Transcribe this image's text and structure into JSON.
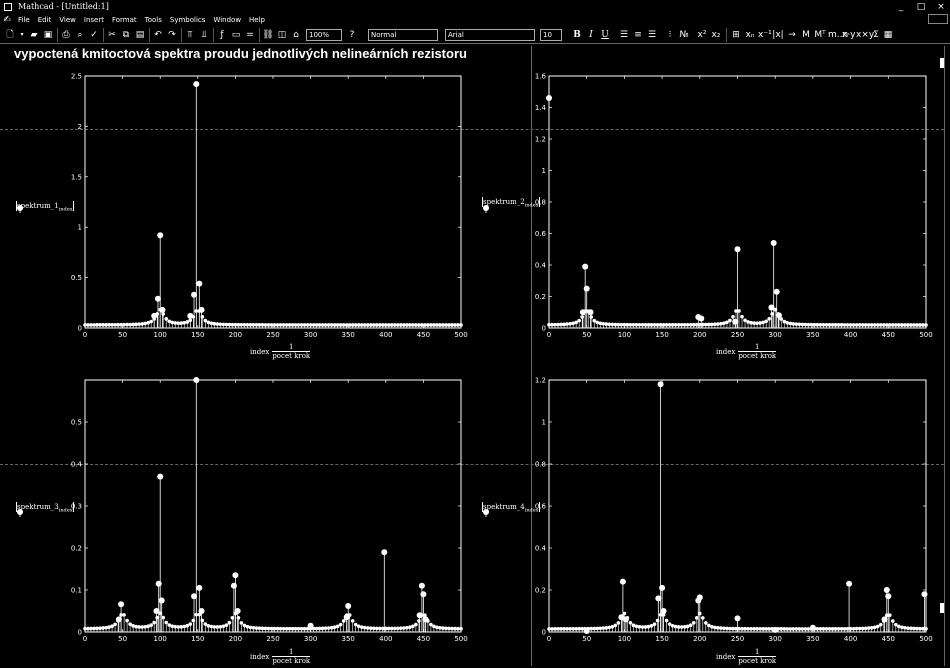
{
  "window": {
    "title": "Mathcad - [Untitled:1]",
    "minimize": "_",
    "maximize": "□",
    "close": "×"
  },
  "menu": [
    "File",
    "Edit",
    "View",
    "Insert",
    "Format",
    "Tools",
    "Symbolics",
    "Window",
    "Help"
  ],
  "toolbar": {
    "zoom": "100%",
    "style": "Normal",
    "font": "Arial",
    "font_size": "10",
    "bold": "B",
    "italic": "I",
    "underline": "U"
  },
  "worksheet": {
    "title": "vypoctená kmitoctová spektra proudu jednotlivých nelineárních rezistoru"
  },
  "colors": {
    "background": "#000000",
    "foreground": "#ffffff",
    "grid": "#555555"
  },
  "chart_data": [
    {
      "type": "scatter",
      "style": "stem",
      "ylabel": {
        "text": "spektrum_1",
        "sub": "index"
      },
      "xlabel": {
        "var": "index",
        "num": "1",
        "den": "pocet krok"
      },
      "xlim": [
        0,
        500
      ],
      "ylim": [
        0,
        2.5
      ],
      "xticks": [
        0,
        50,
        100,
        150,
        200,
        250,
        300,
        350,
        400,
        450,
        500
      ],
      "yticks": [
        0,
        0.5,
        1,
        1.5,
        2,
        2.5
      ],
      "ytick_labels": [
        "0",
        "0.5",
        "1",
        "1.5",
        "2",
        "2.5"
      ],
      "peaks": [
        {
          "x": 100,
          "y": 0.92
        },
        {
          "x": 97,
          "y": 0.29
        },
        {
          "x": 103,
          "y": 0.18
        },
        {
          "x": 148,
          "y": 2.42
        },
        {
          "x": 145,
          "y": 0.33
        },
        {
          "x": 152,
          "y": 0.44
        },
        {
          "x": 155,
          "y": 0.18
        },
        {
          "x": 92,
          "y": 0.12
        },
        {
          "x": 140,
          "y": 0.12
        }
      ],
      "baseline_centers": [
        100,
        150
      ],
      "marker_x": 0
    },
    {
      "type": "scatter",
      "style": "stem",
      "ylabel": {
        "text": "spektrum_2",
        "sub": "index"
      },
      "xlabel": {
        "var": "index",
        "num": "1",
        "den": "pocet krok"
      },
      "xlim": [
        0,
        500
      ],
      "ylim": [
        0,
        1.6
      ],
      "xticks": [
        0,
        50,
        100,
        150,
        200,
        250,
        300,
        350,
        400,
        450,
        500
      ],
      "yticks": [
        0,
        0.2,
        0.4,
        0.6,
        0.8,
        1,
        1.2,
        1.4,
        1.6
      ],
      "ytick_labels": [
        "0",
        "0.2",
        "0.4",
        "0.6",
        "0.8",
        "1",
        "1.2",
        "1.4",
        "1.6"
      ],
      "peaks": [
        {
          "x": 0,
          "y": 1.46
        },
        {
          "x": 48,
          "y": 0.39
        },
        {
          "x": 50,
          "y": 0.25
        },
        {
          "x": 45,
          "y": 0.1
        },
        {
          "x": 55,
          "y": 0.1
        },
        {
          "x": 198,
          "y": 0.07
        },
        {
          "x": 202,
          "y": 0.06
        },
        {
          "x": 250,
          "y": 0.5
        },
        {
          "x": 247,
          "y": 0.04
        },
        {
          "x": 298,
          "y": 0.54
        },
        {
          "x": 302,
          "y": 0.23
        },
        {
          "x": 295,
          "y": 0.13
        },
        {
          "x": 305,
          "y": 0.08
        }
      ],
      "baseline_centers": [
        50,
        250,
        300
      ],
      "marker_x": 0
    },
    {
      "type": "scatter",
      "style": "stem",
      "ylabel": {
        "text": "spektrum_3",
        "sub": "index"
      },
      "xlabel": {
        "var": "index",
        "num": "1",
        "den": "pocet krok"
      },
      "xlim": [
        0,
        500
      ],
      "ylim": [
        0,
        0.6
      ],
      "xticks": [
        0,
        50,
        100,
        150,
        200,
        250,
        300,
        350,
        400,
        450,
        500
      ],
      "yticks": [
        0,
        0.1,
        0.2,
        0.3,
        0.4,
        0.5,
        0.6
      ],
      "ytick_labels": [
        "0",
        "0.1",
        "0.2",
        "0.3",
        "0.4",
        "0.5",
        ""
      ],
      "peaks": [
        {
          "x": 48,
          "y": 0.066
        },
        {
          "x": 45,
          "y": 0.03
        },
        {
          "x": 98,
          "y": 0.115
        },
        {
          "x": 100,
          "y": 0.37
        },
        {
          "x": 102,
          "y": 0.075
        },
        {
          "x": 95,
          "y": 0.05
        },
        {
          "x": 148,
          "y": 0.6
        },
        {
          "x": 145,
          "y": 0.085
        },
        {
          "x": 152,
          "y": 0.105
        },
        {
          "x": 155,
          "y": 0.05
        },
        {
          "x": 198,
          "y": 0.11
        },
        {
          "x": 200,
          "y": 0.135
        },
        {
          "x": 203,
          "y": 0.05
        },
        {
          "x": 300,
          "y": 0.015
        },
        {
          "x": 348,
          "y": 0.035
        },
        {
          "x": 350,
          "y": 0.062
        },
        {
          "x": 398,
          "y": 0.19
        },
        {
          "x": 445,
          "y": 0.04
        },
        {
          "x": 448,
          "y": 0.11
        },
        {
          "x": 450,
          "y": 0.09
        },
        {
          "x": 453,
          "y": 0.03
        }
      ],
      "baseline_centers": [
        50,
        100,
        150,
        200,
        350,
        450
      ],
      "marker_x": 0
    },
    {
      "type": "scatter",
      "style": "stem",
      "ylabel": {
        "text": "spektrum_4",
        "sub": "index"
      },
      "xlabel": {
        "var": "index",
        "num": "1",
        "den": "pocet krok"
      },
      "xlim": [
        0,
        500
      ],
      "ylim": [
        0,
        1.2
      ],
      "xticks": [
        0,
        50,
        100,
        150,
        200,
        250,
        300,
        350,
        400,
        450,
        500
      ],
      "yticks": [
        0,
        0.2,
        0.4,
        0.6,
        0.8,
        1,
        1.2
      ],
      "ytick_labels": [
        "0",
        "0.2",
        "0.4",
        "0.6",
        "0.8",
        "1",
        "1.2"
      ],
      "peaks": [
        {
          "x": 50,
          "y": 0.005
        },
        {
          "x": 98,
          "y": 0.24
        },
        {
          "x": 96,
          "y": 0.07
        },
        {
          "x": 102,
          "y": 0.06
        },
        {
          "x": 145,
          "y": 0.16
        },
        {
          "x": 148,
          "y": 1.18
        },
        {
          "x": 150,
          "y": 0.21
        },
        {
          "x": 152,
          "y": 0.1
        },
        {
          "x": 198,
          "y": 0.15
        },
        {
          "x": 200,
          "y": 0.165
        },
        {
          "x": 250,
          "y": 0.065
        },
        {
          "x": 300,
          "y": 0.01
        },
        {
          "x": 350,
          "y": 0.02
        },
        {
          "x": 398,
          "y": 0.23
        },
        {
          "x": 448,
          "y": 0.2
        },
        {
          "x": 450,
          "y": 0.17
        },
        {
          "x": 445,
          "y": 0.06
        },
        {
          "x": 498,
          "y": 0.18
        }
      ],
      "baseline_centers": [
        100,
        150,
        200,
        450
      ],
      "marker_x": 0
    }
  ]
}
